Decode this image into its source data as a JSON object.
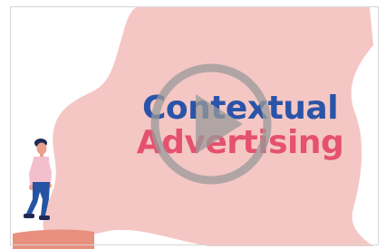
{
  "video": {
    "title_line1": "Contextual",
    "title_line2": "Advertising"
  },
  "colors": {
    "background": "#ffffff",
    "blob": "#f4c7c4",
    "ledge": "#e98f7d",
    "title_line1": "#2a54a8",
    "title_line2": "#e5516e",
    "play_overlay": "#9a9a9a"
  },
  "icons": {
    "play": "play-icon"
  }
}
